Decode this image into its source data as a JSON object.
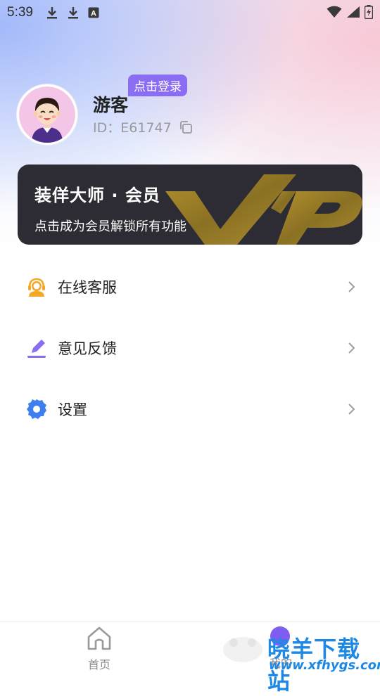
{
  "status_bar": {
    "time": "5:39",
    "icons": [
      "download-icon",
      "download-icon",
      "font-icon",
      "wifi-icon",
      "signal-icon",
      "battery-icon"
    ]
  },
  "profile": {
    "username": "游客",
    "login_chip": "点击登录",
    "id_text": "ID：E61747"
  },
  "vip_card": {
    "title": "装佯大师 · 会员",
    "subtitle": "点击成为会员解锁所有功能",
    "watermark": "VIP"
  },
  "menu": {
    "items": [
      {
        "label": "在线客服",
        "icon": "customer-service-icon"
      },
      {
        "label": "意见反馈",
        "icon": "edit-icon"
      },
      {
        "label": "设置",
        "icon": "gear-icon"
      }
    ]
  },
  "tabbar": {
    "home_label": "首页",
    "mine_label": "我的"
  },
  "site_watermark": {
    "cn": "晓羊下载站",
    "url": "www.xfhygs.com"
  },
  "colors": {
    "accent": "#8b6df3",
    "vip_card_bg": "#2d2c34",
    "vip_gold": "#a98a2e",
    "watermark_blue": "#1e88e5"
  }
}
